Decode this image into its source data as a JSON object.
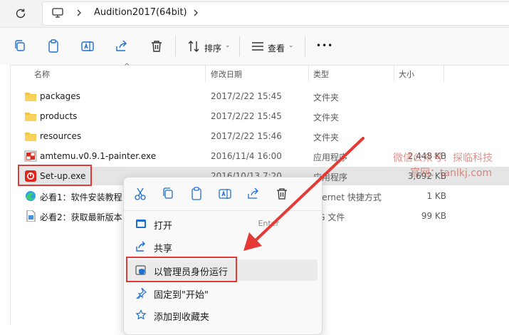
{
  "address_bar": {
    "breadcrumb": [
      "Audition2017(64bit)"
    ]
  },
  "toolbar": {
    "sort_label": "排序",
    "view_label": "查看",
    "more_label": "•••"
  },
  "columns": {
    "name": "名称",
    "modified": "修改日期",
    "type": "类型",
    "size": "大小"
  },
  "files": [
    {
      "name": "packages",
      "date": "2017/2/22 15:45",
      "type": "文件夹",
      "size": "",
      "icon": "folder-icon"
    },
    {
      "name": "products",
      "date": "2017/2/22 15:45",
      "type": "文件夹",
      "size": "",
      "icon": "folder-icon"
    },
    {
      "name": "resources",
      "date": "2017/2/22 15:46",
      "type": "文件夹",
      "size": "",
      "icon": "folder-icon"
    },
    {
      "name": "amtemu.v0.9.1-painter.exe",
      "date": "2016/11/4 16:00",
      "type": "应用程序",
      "size": "2,448 KB",
      "icon": "amtemu-exe-icon"
    },
    {
      "name": "Set-up.exe",
      "date": "2016/10/13 7:20",
      "type": "应用程序",
      "size": "3,692 KB",
      "icon": "adobe-setup-icon"
    },
    {
      "name": "必看1：软件安装教程",
      "date": "",
      "type": "nternet 快捷方式",
      "size": "1 KB",
      "icon": "edge-shortcut-icon"
    },
    {
      "name": "必看2：获取最新版本",
      "date": "",
      "type": "PG 文件",
      "size": "99 KB",
      "icon": "image-file-icon"
    }
  ],
  "context_menu": {
    "quick_actions": [
      "cut-icon",
      "copy-icon",
      "paste-icon",
      "rename-icon",
      "share-icon",
      "delete-icon"
    ],
    "items": [
      {
        "label": "打开",
        "accel": "Enter",
        "icon": "open-icon"
      },
      {
        "label": "共享",
        "accel": "",
        "icon": "share-icon"
      },
      {
        "label": "以管理员身份运行",
        "accel": "",
        "icon": "shield-icon"
      },
      {
        "label": "固定到\"开始\"",
        "accel": "",
        "icon": "pin-icon"
      },
      {
        "label": "添加到收藏夹",
        "accel": "",
        "icon": "star-icon"
      }
    ]
  },
  "watermark": {
    "line1": "微信公众号：探临科技",
    "line2": "官网：tanlkj.com"
  },
  "colors": {
    "highlight_red": "#e53935",
    "selection": "#e5e5e5",
    "folder": "#f4c542"
  }
}
